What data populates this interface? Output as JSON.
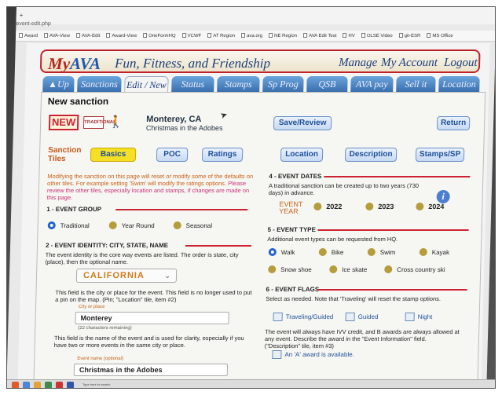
{
  "browser": {
    "url_fragment": "event-edit.php",
    "bookmarks": [
      "Award",
      "AVA-View",
      "AVA-Edit",
      "Award-View",
      "OneFormHQ",
      "VCWF",
      "AT Region",
      "ava.org",
      "NE Region",
      "AVA Edit Test",
      "HV",
      "OLSE Video",
      "git-ESR",
      "MS Office"
    ]
  },
  "header": {
    "logo": "MyAVA",
    "tagline": "Fun, Fitness, and Friendship",
    "links": [
      "Manage",
      "My Account",
      "Logout"
    ]
  },
  "nav_tabs": [
    "Up",
    "Sanctions",
    "Edit / New",
    "Status",
    "Stamps",
    "Sp Prog",
    "QSB",
    "AVA pay",
    "Sell it",
    "Location"
  ],
  "page": {
    "title": "New sanction",
    "new_badge": "NEW",
    "traditional_badge": "TRADITIONAL",
    "event_city": "Monterey, CA",
    "event_name": "Christmas in the Adobes",
    "save_review_label": "Save/Review",
    "return_label": "Return",
    "sanction_tiles_label": "Sanction Tiles",
    "tiles": [
      "Basics",
      "POC",
      "Ratings",
      "Location",
      "Description",
      "Stamps/SP"
    ],
    "active_tile": "Basics"
  },
  "left": {
    "intro": "Modifying the sanction on this page will reset or modify some of the defaults on other tiles. For example setting 'Swim' will modify the ratings options.",
    "intro_highlight": "Please review the other tiles, especially location and stamps, if changes are made on this page.",
    "event_group": {
      "title": "1 - EVENT GROUP",
      "options": [
        "Traditional",
        "Year Round",
        "Seasonal"
      ],
      "selected": "Traditional"
    },
    "identity": {
      "title": "2 - EVENT IDENTITY: CITY, STATE, NAME",
      "description": "The event identity is the core way events are listed. The order is state, city (place), then the optional name.",
      "state_value": "CALIFORNIA",
      "city_help": "This field is the city or place for the event. This field is no longer used to put a pin on the map. (Pin; \"Location\" tile, item #2)",
      "city_label": "City or place",
      "city_value": "Monterey",
      "city_remaining": "(22 characters remaining)",
      "name_help": "This field is the name of the event and is used for clarity, especially if you have two or more events in the same city or place.",
      "name_label": "Event name (optional)",
      "name_value": "Christmas in the Adobes"
    }
  },
  "right": {
    "dates": {
      "title": "4 - EVENT DATES",
      "description": "A traditional sanction can be created up to two years (730 days) in advance.",
      "year_label": "EVENT YEAR",
      "years": [
        "2022",
        "2023",
        "2024"
      ]
    },
    "type": {
      "title": "5 - EVENT TYPE",
      "description": "Additional event types can be requested from HQ.",
      "options": [
        "Walk",
        "Bike",
        "Swim",
        "Kayak",
        "Snow shoe",
        "Ice skate",
        "Cross country ski"
      ],
      "selected": "Walk"
    },
    "flags": {
      "title": "6 - EVENT FLAGS",
      "description": "Select as needed. Note that 'Traveling' will reset the stamp options.",
      "options": [
        "Traveling/Guided",
        "Guided",
        "Night"
      ],
      "note": "The event will always have IVV credit, and B awards are always allowed at any event. Describe the award in the \"Event Information\" field. (\"Description\" tile, item #3)",
      "a_award_label": "An 'A' award is available."
    }
  },
  "taskbar": {
    "search_hint": "Type here to search"
  }
}
